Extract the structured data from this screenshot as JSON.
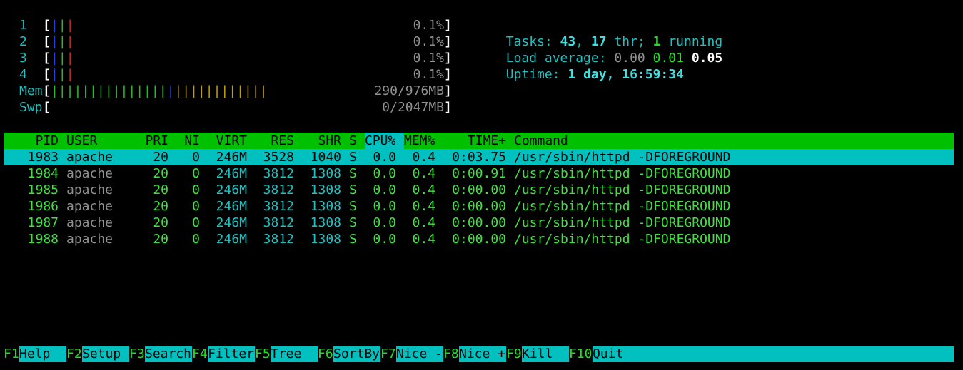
{
  "cpu_meters": [
    {
      "label": "1",
      "value": "0.1%"
    },
    {
      "label": "2",
      "value": "0.1%"
    },
    {
      "label": "3",
      "value": "0.1%"
    },
    {
      "label": "4",
      "value": "0.1%"
    }
  ],
  "mem": {
    "label": "Mem",
    "value": "290/976MB",
    "green_bars": 15,
    "blue_bars": 1,
    "yellow_bars": 12
  },
  "swp": {
    "label": "Swp",
    "value": "0/2047MB"
  },
  "summary": {
    "tasks_label": "Tasks: ",
    "tasks_count": "43",
    "tasks_sep": ", ",
    "threads_count": "17",
    "threads_label": " thr; ",
    "running_count": "1",
    "running_label": " running",
    "load_label": "Load average: ",
    "load_1": "0.00",
    "load_5": "0.01",
    "load_15": "0.05",
    "uptime_label": "Uptime: ",
    "uptime_value": "1 day, 16:59:34"
  },
  "columns": {
    "pid": "PID",
    "user": "USER",
    "pri": "PRI",
    "ni": "NI",
    "virt": "VIRT",
    "res": "RES",
    "shr": "SHR",
    "s": "S",
    "cpu": "CPU%",
    "mem": "MEM%",
    "time": "TIME+",
    "command": "Command"
  },
  "processes": [
    {
      "pid": "1983",
      "user": "apache",
      "pri": "20",
      "ni": "0",
      "virt": "246M",
      "res": "3528",
      "shr": "1040",
      "s": "S",
      "cpu": "0.0",
      "mem": "0.4",
      "time": "0:03.75",
      "command": "/usr/sbin/httpd -DFOREGROUND"
    },
    {
      "pid": "1984",
      "user": "apache",
      "pri": "20",
      "ni": "0",
      "virt": "246M",
      "res": "3812",
      "shr": "1308",
      "s": "S",
      "cpu": "0.0",
      "mem": "0.4",
      "time": "0:00.91",
      "command": "/usr/sbin/httpd -DFOREGROUND"
    },
    {
      "pid": "1985",
      "user": "apache",
      "pri": "20",
      "ni": "0",
      "virt": "246M",
      "res": "3812",
      "shr": "1308",
      "s": "S",
      "cpu": "0.0",
      "mem": "0.4",
      "time": "0:00.00",
      "command": "/usr/sbin/httpd -DFOREGROUND"
    },
    {
      "pid": "1986",
      "user": "apache",
      "pri": "20",
      "ni": "0",
      "virt": "246M",
      "res": "3812",
      "shr": "1308",
      "s": "S",
      "cpu": "0.0",
      "mem": "0.4",
      "time": "0:00.00",
      "command": "/usr/sbin/httpd -DFOREGROUND"
    },
    {
      "pid": "1987",
      "user": "apache",
      "pri": "20",
      "ni": "0",
      "virt": "246M",
      "res": "3812",
      "shr": "1308",
      "s": "S",
      "cpu": "0.0",
      "mem": "0.4",
      "time": "0:00.00",
      "command": "/usr/sbin/httpd -DFOREGROUND"
    },
    {
      "pid": "1988",
      "user": "apache",
      "pri": "20",
      "ni": "0",
      "virt": "246M",
      "res": "3812",
      "shr": "1308",
      "s": "S",
      "cpu": "0.0",
      "mem": "0.4",
      "time": "0:00.00",
      "command": "/usr/sbin/httpd -DFOREGROUND"
    }
  ],
  "footer": [
    {
      "key": "F1",
      "label": "Help"
    },
    {
      "key": "F2",
      "label": "Setup"
    },
    {
      "key": "F3",
      "label": "Search"
    },
    {
      "key": "F4",
      "label": "Filter"
    },
    {
      "key": "F5",
      "label": "Tree"
    },
    {
      "key": "F6",
      "label": "SortBy"
    },
    {
      "key": "F7",
      "label": "Nice -"
    },
    {
      "key": "F8",
      "label": "Nice +"
    },
    {
      "key": "F9",
      "label": "Kill"
    },
    {
      "key": "F10",
      "label": "Quit"
    }
  ],
  "colors": {
    "background": "#000000",
    "header_bg": "#00c000",
    "selected_bg": "#00c0c0",
    "footer_bg": "#00c0c0",
    "cyan": "#20c0c0",
    "green": "#40e040"
  }
}
